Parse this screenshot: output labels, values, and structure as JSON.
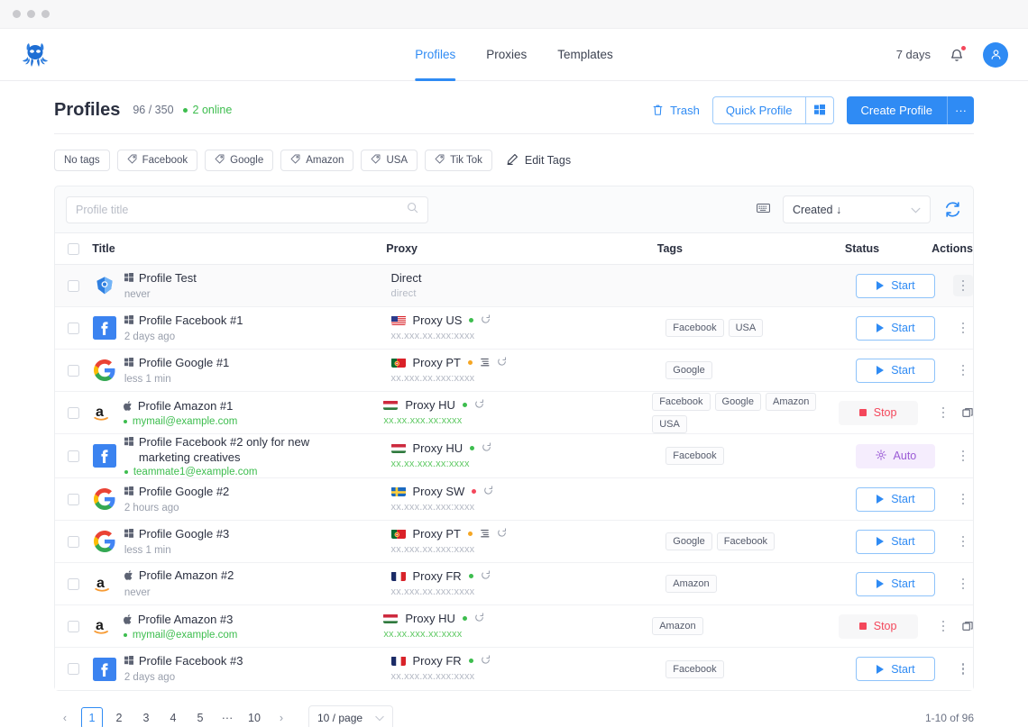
{
  "window": {
    "dots": [
      "close-dot",
      "minimize-dot",
      "maximize-dot"
    ]
  },
  "nav": {
    "logo_name": "octopus-logo",
    "tabs": [
      {
        "label": "Profiles",
        "active": true
      },
      {
        "label": "Proxies",
        "active": false
      },
      {
        "label": "Templates",
        "active": false
      }
    ],
    "days": "7 days",
    "bell_icon": "bell-icon",
    "avatar_icon": "user-avatar-icon"
  },
  "header": {
    "title": "Profiles",
    "counts": "96 / 350",
    "online": "2 online",
    "trash_label": "Trash",
    "quick_profile_label": "Quick Profile",
    "quick_profile_side_icon": "windows-icon",
    "create_profile_label": "Create Profile",
    "create_profile_side_label": "···"
  },
  "tagbar": {
    "chips": [
      {
        "label": "No tags",
        "icon": null
      },
      {
        "label": "Facebook",
        "icon": "tag-icon"
      },
      {
        "label": "Google",
        "icon": "tag-icon"
      },
      {
        "label": "Amazon",
        "icon": "tag-icon"
      },
      {
        "label": "USA",
        "icon": "tag-icon"
      },
      {
        "label": "Tik Tok",
        "icon": "tag-icon"
      }
    ],
    "edit_label": "Edit Tags",
    "edit_icon": "pencil-icon"
  },
  "toolbar": {
    "search_placeholder": "Profile title",
    "search_value": "",
    "search_icon": "search-icon",
    "keyboard_icon": "keyboard-icon",
    "sort_value": "Created ↓",
    "refresh_icon": "refresh-icon"
  },
  "table": {
    "columns": [
      "Title",
      "Proxy",
      "Tags",
      "Status",
      "Actions"
    ],
    "rows": [
      {
        "icon": "chrome-profile-icon",
        "os_icon": "windows-icon",
        "title": "Profile Test",
        "sub": "never",
        "sub_type": "time",
        "proxy_name": "Direct",
        "proxy_flag": null,
        "proxy_dot": null,
        "proxy_has_filter": false,
        "proxy_has_refresh": false,
        "ip": "direct",
        "ip_green": false,
        "tags": [],
        "status": "Start",
        "status_type": "start",
        "has_window_icon": false,
        "highlight": true
      },
      {
        "icon": "facebook-icon",
        "os_icon": "windows-icon",
        "title": "Profile Facebook #1",
        "sub": "2 days ago",
        "sub_type": "time",
        "proxy_name": "Proxy US",
        "proxy_flag": "us",
        "proxy_dot": "#3dbd4e",
        "proxy_has_filter": false,
        "proxy_has_refresh": true,
        "ip": "xx.xxx.xx.xxx:xxxx",
        "ip_green": false,
        "tags": [
          "Facebook",
          "USA"
        ],
        "status": "Start",
        "status_type": "start",
        "has_window_icon": false,
        "highlight": false
      },
      {
        "icon": "google-icon",
        "os_icon": "windows-icon",
        "title": "Profile Google #1",
        "sub": "less 1 min",
        "sub_type": "time",
        "proxy_name": "Proxy PT",
        "proxy_flag": "pt",
        "proxy_dot": "#f5a623",
        "proxy_has_filter": true,
        "proxy_has_refresh": true,
        "ip": "xx.xxx.xx.xxx:xxxx",
        "ip_green": false,
        "tags": [
          "Google"
        ],
        "status": "Start",
        "status_type": "start",
        "has_window_icon": false,
        "highlight": false
      },
      {
        "icon": "amazon-icon",
        "os_icon": "apple-icon",
        "title": "Profile Amazon #1",
        "sub": "mymail@example.com",
        "sub_type": "mail",
        "proxy_name": "Proxy HU",
        "proxy_flag": "hu",
        "proxy_dot": "#3dbd4e",
        "proxy_has_filter": false,
        "proxy_has_refresh": true,
        "ip": "xx.xx.xxx.xx:xxxx",
        "ip_green": true,
        "tags": [
          "Facebook",
          "Google",
          "Amazon",
          "USA"
        ],
        "status": "Stop",
        "status_type": "stop",
        "has_window_icon": true,
        "highlight": false
      },
      {
        "icon": "facebook-icon",
        "os_icon": "windows-icon",
        "title": "Profile Facebook #2 only for new marketing creatives",
        "sub": "teammate1@example.com",
        "sub_type": "mail",
        "proxy_name": "Proxy HU",
        "proxy_flag": "hu",
        "proxy_dot": "#3dbd4e",
        "proxy_has_filter": false,
        "proxy_has_refresh": true,
        "ip": "xx.xx.xxx.xx:xxxx",
        "ip_green": true,
        "tags": [
          "Facebook"
        ],
        "status": "Auto",
        "status_type": "auto",
        "has_window_icon": false,
        "highlight": false
      },
      {
        "icon": "google-icon",
        "os_icon": "windows-icon",
        "title": "Profile Google #2",
        "sub": "2 hours ago",
        "sub_type": "time",
        "proxy_name": "Proxy SW",
        "proxy_flag": "sw",
        "proxy_dot": "#f4475b",
        "proxy_has_filter": false,
        "proxy_has_refresh": true,
        "ip": "xx.xxx.xx.xxx:xxxx",
        "ip_green": false,
        "tags": [],
        "status": "Start",
        "status_type": "start",
        "has_window_icon": false,
        "highlight": false
      },
      {
        "icon": "google-icon",
        "os_icon": "windows-icon",
        "title": "Profile Google #3",
        "sub": "less 1 min",
        "sub_type": "time",
        "proxy_name": "Proxy PT",
        "proxy_flag": "pt",
        "proxy_dot": "#f5a623",
        "proxy_has_filter": true,
        "proxy_has_refresh": true,
        "ip": "xx.xxx.xx.xxx:xxxx",
        "ip_green": false,
        "tags": [
          "Google",
          "Facebook"
        ],
        "status": "Start",
        "status_type": "start",
        "has_window_icon": false,
        "highlight": false
      },
      {
        "icon": "amazon-icon",
        "os_icon": "apple-icon",
        "title": "Profile Amazon #2",
        "sub": "never",
        "sub_type": "time",
        "proxy_name": "Proxy FR",
        "proxy_flag": "fr",
        "proxy_dot": "#3dbd4e",
        "proxy_has_filter": false,
        "proxy_has_refresh": true,
        "ip": "xx.xxx.xx.xxx:xxxx",
        "ip_green": false,
        "tags": [
          "Amazon"
        ],
        "status": "Start",
        "status_type": "start",
        "has_window_icon": false,
        "highlight": false
      },
      {
        "icon": "amazon-icon",
        "os_icon": "apple-icon",
        "title": "Profile Amazon #3",
        "sub": "mymail@example.com",
        "sub_type": "mail",
        "proxy_name": "Proxy HU",
        "proxy_flag": "hu",
        "proxy_dot": "#3dbd4e",
        "proxy_has_filter": false,
        "proxy_has_refresh": true,
        "ip": "xx.xx.xxx.xx:xxxx",
        "ip_green": true,
        "tags": [
          "Amazon"
        ],
        "status": "Stop",
        "status_type": "stop",
        "has_window_icon": true,
        "highlight": false
      },
      {
        "icon": "facebook-icon",
        "os_icon": "windows-icon",
        "title": "Profile Facebook #3",
        "sub": "2 days ago",
        "sub_type": "time",
        "proxy_name": "Proxy FR",
        "proxy_flag": "fr",
        "proxy_dot": "#3dbd4e",
        "proxy_has_filter": false,
        "proxy_has_refresh": true,
        "ip": "xx.xxx.xx.xxx:xxxx",
        "ip_green": false,
        "tags": [
          "Facebook"
        ],
        "status": "Start",
        "status_type": "start",
        "has_window_icon": false,
        "highlight": false
      }
    ]
  },
  "pagination": {
    "prev": "‹",
    "next": "›",
    "pages": [
      "1",
      "2",
      "3",
      "4",
      "5",
      "···",
      "10"
    ],
    "current": "1",
    "per_page": "10 / page",
    "total": "1-10 of 96"
  },
  "colors": {
    "accent": "#2f8bf4",
    "green": "#3dbd4e",
    "red": "#f4475b",
    "purple": "#9b5bd6",
    "orange": "#f5a623"
  }
}
